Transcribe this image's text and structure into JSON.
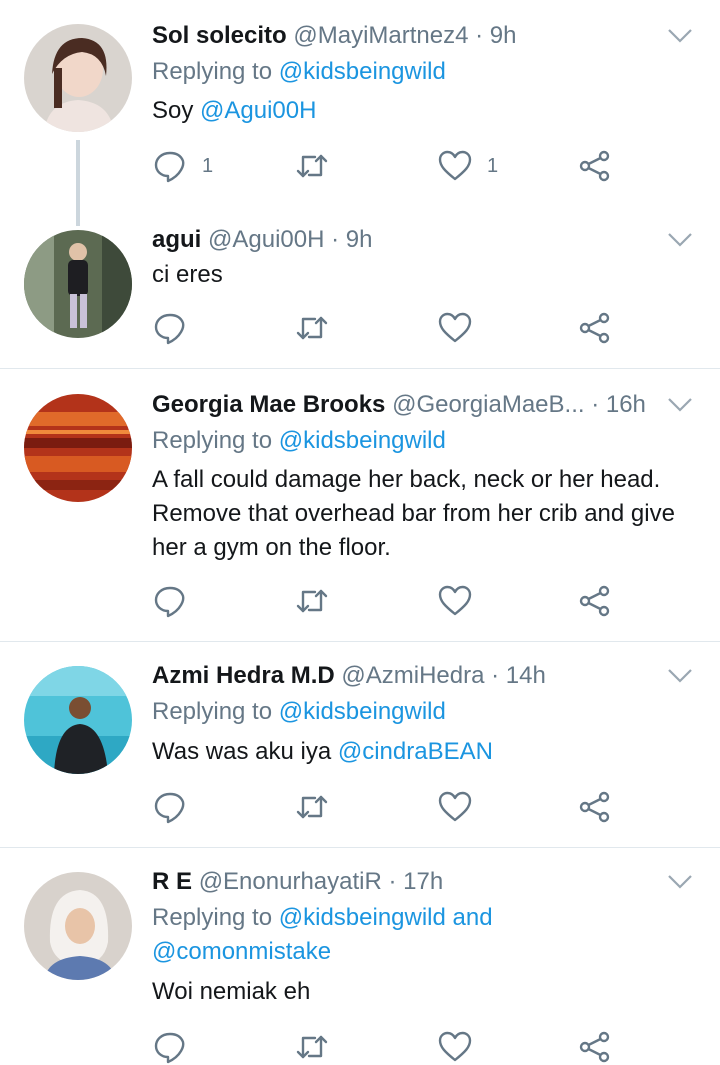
{
  "colors": {
    "link": "#1b95e0",
    "secondary_text": "#657786",
    "divider": "#e1e8ed",
    "thread_line": "#ccd6dd",
    "icon": "#657786"
  },
  "icons": {
    "reply": "speech-bubble-icon",
    "retweet": "retweet-arrows-icon",
    "like": "heart-icon",
    "share": "share-nodes-icon",
    "menu": "chevron-down-icon"
  },
  "tweets": [
    {
      "name": "Sol solecito",
      "handle": "@MayiMartnez4",
      "time": "· 9h",
      "replying_prefix": "Replying to",
      "replying_to": "@kidsbeingwild",
      "body_prefix": "Soy",
      "body_mention": "@Agui00H",
      "reply_count": "1",
      "like_count": "1"
    },
    {
      "name": "agui",
      "handle": "@Agui00H",
      "time": "· 9h",
      "body": "ci eres"
    },
    {
      "name": "Georgia Mae Brooks",
      "handle": "@GeorgiaMaeB...",
      "time": "· 16h",
      "replying_prefix": "Replying to",
      "replying_to": "@kidsbeingwild",
      "body_lines": [
        "A fall could damage her back, neck or her head.",
        "Remove that overhead bar from her crib and give",
        "her a gym on the floor."
      ]
    },
    {
      "name": "Azmi Hedra M.D",
      "handle": "@AzmiHedra",
      "time": "· 14h",
      "replying_prefix": "Replying to",
      "replying_to": "@kidsbeingwild",
      "body_prefix": "Was was aku iya",
      "body_mention": "@cindraBEAN"
    },
    {
      "name": "R E",
      "handle": "@EnonurhayatiR",
      "time": "· 17h",
      "replying_prefix": "Replying to",
      "replying_to": "@kidsbeingwild and",
      "replying_to_2": "@comonmistake",
      "body": "Woi nemiak eh"
    }
  ]
}
